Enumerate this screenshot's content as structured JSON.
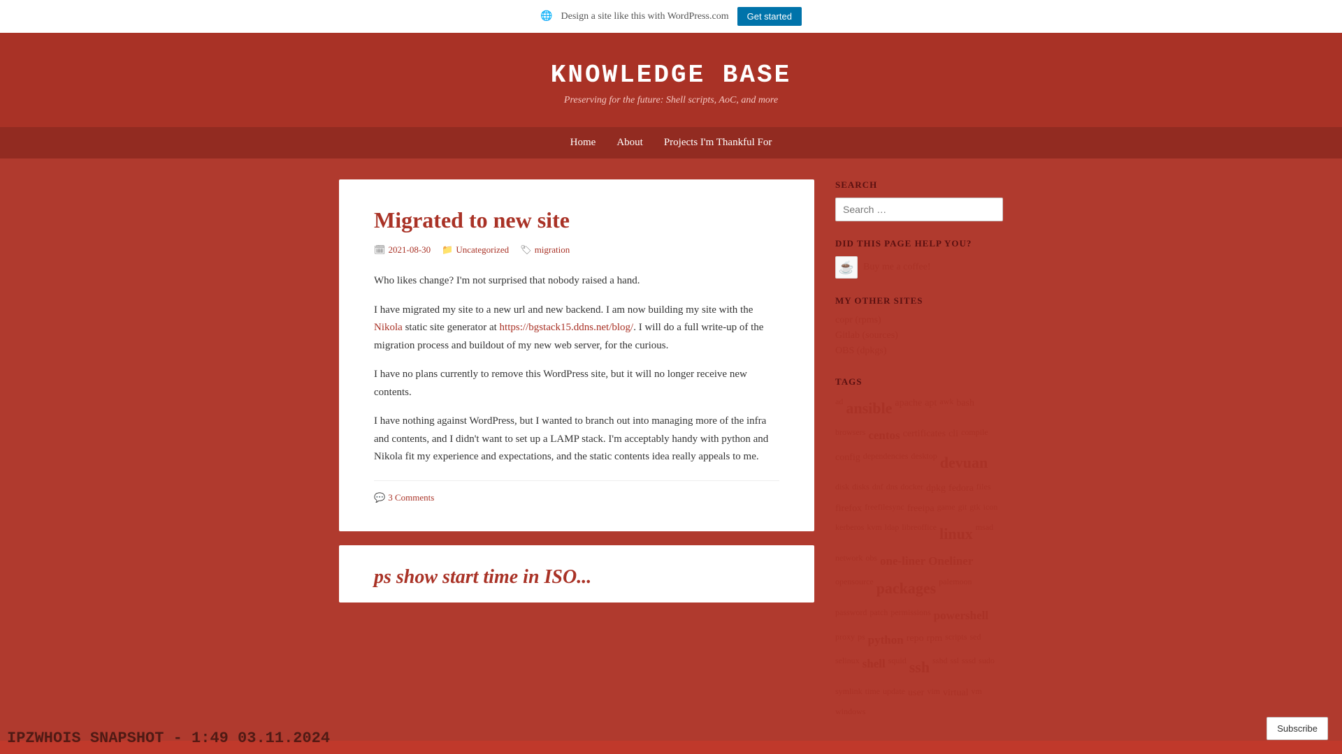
{
  "banner": {
    "text": "Design a site like this with WordPress.com",
    "button_label": "Get started",
    "wp_icon": "🌐"
  },
  "header": {
    "title": "KNOWLEDGE BASE",
    "tagline": "Preserving for the future: Shell scripts, AoC, and more"
  },
  "nav": {
    "items": [
      {
        "label": "Home",
        "href": "#"
      },
      {
        "label": "About",
        "href": "#"
      },
      {
        "label": "Projects I'm Thankful For",
        "href": "#"
      }
    ]
  },
  "post": {
    "title": "Migrated to new site",
    "date": "2021-08-30",
    "category": "Uncategorized",
    "tag": "migration",
    "paragraphs": [
      "Who likes change? I'm not surprised that nobody raised a hand.",
      "I have migrated my site to a new url and new backend. I am now building my site with the Nikola static site generator at https://bgstack15.ddns.net/blog/. I will do a full write-up of the migration process and buildout of my new web server, for the curious.",
      "I have no plans currently to remove this WordPress site, but it will no longer receive new contents.",
      "I have nothing against WordPress, but I wanted to branch out into managing more of the infra and contents, and I didn't want to set up a LAMP stack. I'm acceptably handy with python and Nikola fit my experience and expectations, and the static contents idea really appeals to me."
    ],
    "nikola_link": "Nikola",
    "nikola_url": "https://bgstack15.ddns.net/blog/",
    "comments": "3 Comments"
  },
  "post_preview": {
    "title": "ps show start time in ISO..."
  },
  "sidebar": {
    "search": {
      "heading": "SEARCH",
      "placeholder": "Search …"
    },
    "did_this_help": {
      "heading": "DID THIS PAGE HELP YOU?",
      "coffee_text": "Buy me a coffee!"
    },
    "other_sites": {
      "heading": "MY OTHER SITES",
      "links": [
        {
          "label": "copr (rpms)",
          "href": "#"
        },
        {
          "label": "Gitlab (sources)",
          "href": "#"
        },
        {
          "label": "OBS (dpkgs)",
          "href": "#"
        }
      ]
    },
    "tags": {
      "heading": "TAGS",
      "items": [
        {
          "label": "ad",
          "size": "xs"
        },
        {
          "label": "ansible",
          "size": "lg"
        },
        {
          "label": "apache",
          "size": "sm"
        },
        {
          "label": "apt",
          "size": "sm"
        },
        {
          "label": "awk",
          "size": "xs"
        },
        {
          "label": "bash",
          "size": "sm"
        },
        {
          "label": "browsers",
          "size": "xs"
        },
        {
          "label": "centos",
          "size": "md"
        },
        {
          "label": "certificates",
          "size": "sm"
        },
        {
          "label": "cli",
          "size": "sm"
        },
        {
          "label": "compile",
          "size": "xs"
        },
        {
          "label": "config",
          "size": "sm"
        },
        {
          "label": "dependencies",
          "size": "xs"
        },
        {
          "label": "desktop",
          "size": "xs"
        },
        {
          "label": "devuan",
          "size": "lg"
        },
        {
          "label": "disk",
          "size": "xs"
        },
        {
          "label": "disks",
          "size": "xs"
        },
        {
          "label": "dnf",
          "size": "xs"
        },
        {
          "label": "dns",
          "size": "xs"
        },
        {
          "label": "docker",
          "size": "xs"
        },
        {
          "label": "dpkg",
          "size": "sm"
        },
        {
          "label": "fedora",
          "size": "sm"
        },
        {
          "label": "files",
          "size": "xs"
        },
        {
          "label": "firefox",
          "size": "sm"
        },
        {
          "label": "freefilesync",
          "size": "xs"
        },
        {
          "label": "freeipa",
          "size": "sm"
        },
        {
          "label": "game",
          "size": "xs"
        },
        {
          "label": "git",
          "size": "xs"
        },
        {
          "label": "gtk",
          "size": "xs"
        },
        {
          "label": "icon",
          "size": "xs"
        },
        {
          "label": "kerberos",
          "size": "xs"
        },
        {
          "label": "kvm",
          "size": "xs"
        },
        {
          "label": "ldap",
          "size": "xs"
        },
        {
          "label": "libreoffice",
          "size": "xs"
        },
        {
          "label": "linux",
          "size": "lg"
        },
        {
          "label": "msad",
          "size": "xs"
        },
        {
          "label": "network",
          "size": "xs"
        },
        {
          "label": "obs",
          "size": "xs"
        },
        {
          "label": "one-liner",
          "size": "md"
        },
        {
          "label": "Oneliner",
          "size": "md"
        },
        {
          "label": "opensource",
          "size": "xs"
        },
        {
          "label": "packages",
          "size": "lg"
        },
        {
          "label": "palemoon",
          "size": "xs"
        },
        {
          "label": "password",
          "size": "xs"
        },
        {
          "label": "patch",
          "size": "xs"
        },
        {
          "label": "permissions",
          "size": "xs"
        },
        {
          "label": "powershell",
          "size": "md"
        },
        {
          "label": "proxy",
          "size": "xs"
        },
        {
          "label": "ps",
          "size": "xs"
        },
        {
          "label": "python",
          "size": "md"
        },
        {
          "label": "repo",
          "size": "sm"
        },
        {
          "label": "rpm",
          "size": "sm"
        },
        {
          "label": "scripts",
          "size": "xs"
        },
        {
          "label": "sed",
          "size": "xs"
        },
        {
          "label": "selinux",
          "size": "xs"
        },
        {
          "label": "shell",
          "size": "md"
        },
        {
          "label": "squid",
          "size": "xs"
        },
        {
          "label": "ssh",
          "size": "lg"
        },
        {
          "label": "sshd",
          "size": "xs"
        },
        {
          "label": "ssl",
          "size": "xs"
        },
        {
          "label": "sssd",
          "size": "xs"
        },
        {
          "label": "sudo",
          "size": "xs"
        },
        {
          "label": "symlink",
          "size": "xs"
        },
        {
          "label": "time",
          "size": "xs"
        },
        {
          "label": "update",
          "size": "xs"
        },
        {
          "label": "user",
          "size": "sm"
        },
        {
          "label": "vim",
          "size": "xs"
        },
        {
          "label": "virtual",
          "size": "sm"
        },
        {
          "label": "vm",
          "size": "xs"
        },
        {
          "label": "windows",
          "size": "xs"
        }
      ]
    }
  },
  "subscribe": {
    "label": "Subscribe"
  },
  "watermark": {
    "text": "IPZWHOIS SNAPSHOT - 1:49 03.11.2024"
  }
}
